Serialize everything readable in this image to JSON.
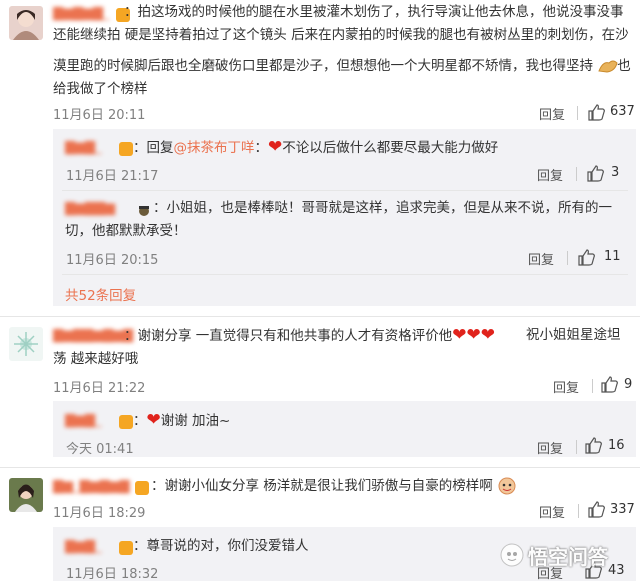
{
  "comments": [
    {
      "text_1": "：拍这场戏的时候他的腿在水里被灌木划伤了，执行导演让他去休息，他说没事没事",
      "text_2": "还能继续拍 硬是坚持着拍过了这个镜头  后来在内蒙拍的时候我的腿也有被树丛里的刺划伤，在沙",
      "text_3": "漠里跑的时候脚后跟也全磨破伤口里都是沙子，但想想他一个大明星都不矫情，我也得坚持",
      "text_4": "给我做了个榜样",
      "time": "11月6日 20:11",
      "reply": "回复",
      "likes": "637"
    },
    {
      "text_prefix": "：回复",
      "mention": "@抹茶布丁咩",
      "text_suffix": "：",
      "text_after": "不论以后做什么都要尽最大能力做好",
      "time": "11月6日 21:17",
      "reply": "回复",
      "likes": "3"
    },
    {
      "text_1": "：小姐姐，也是棒棒哒！哥哥就是这样，追求完美，但是从来不说，所有的一",
      "text_2": "切，他都默默承受！",
      "time": "11月6日 20:15",
      "reply": "回复",
      "likes": "11"
    },
    {
      "more_replies": "共52条回复"
    },
    {
      "text_1": "：谢谢分享 一直觉得只有和他共事的人才有资格评价他",
      "text_1b": "祝小姐姐星途坦",
      "text_2": "荡 越来越好哦",
      "time": "11月6日 21:22",
      "reply": "回复",
      "likes": "9"
    },
    {
      "text_1": "：",
      "text_after": "谢谢 加油~",
      "time": "今天 01:41",
      "reply": "回复",
      "likes": "16"
    },
    {
      "text_1": "：谢谢小仙女分享 杨洋就是很让我们骄傲与自豪的榜样啊",
      "time": "11月6日 18:29",
      "reply": "回复",
      "likes": "337"
    },
    {
      "text_1": "：尊哥说的对，你们没爱错人",
      "time": "11月6日 18:32",
      "reply": "回复",
      "likes": "43"
    }
  ],
  "watermark": "悟空问答",
  "colors": {
    "accent": "#eb7350",
    "heart": "#e0231c",
    "subbox": "#f2f2f5"
  }
}
